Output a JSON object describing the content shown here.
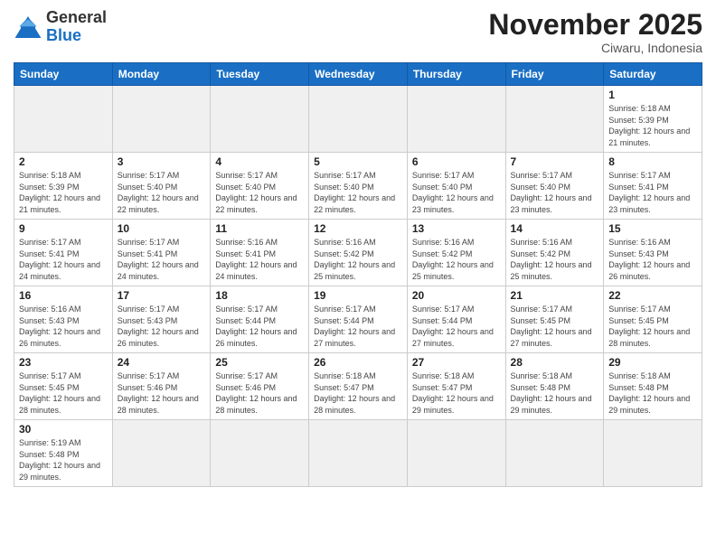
{
  "logo": {
    "text_general": "General",
    "text_blue": "Blue"
  },
  "header": {
    "month_year": "November 2025",
    "location": "Ciwaru, Indonesia"
  },
  "days_of_week": [
    "Sunday",
    "Monday",
    "Tuesday",
    "Wednesday",
    "Thursday",
    "Friday",
    "Saturday"
  ],
  "weeks": [
    [
      {
        "day": "",
        "empty": true
      },
      {
        "day": "",
        "empty": true
      },
      {
        "day": "",
        "empty": true
      },
      {
        "day": "",
        "empty": true
      },
      {
        "day": "",
        "empty": true
      },
      {
        "day": "",
        "empty": true
      },
      {
        "day": "1",
        "sunrise": "5:18 AM",
        "sunset": "5:39 PM",
        "daylight": "12 hours and 21 minutes."
      }
    ],
    [
      {
        "day": "2",
        "sunrise": "5:18 AM",
        "sunset": "5:39 PM",
        "daylight": "12 hours and 21 minutes."
      },
      {
        "day": "3",
        "sunrise": "5:17 AM",
        "sunset": "5:40 PM",
        "daylight": "12 hours and 22 minutes."
      },
      {
        "day": "4",
        "sunrise": "5:17 AM",
        "sunset": "5:40 PM",
        "daylight": "12 hours and 22 minutes."
      },
      {
        "day": "5",
        "sunrise": "5:17 AM",
        "sunset": "5:40 PM",
        "daylight": "12 hours and 22 minutes."
      },
      {
        "day": "6",
        "sunrise": "5:17 AM",
        "sunset": "5:40 PM",
        "daylight": "12 hours and 23 minutes."
      },
      {
        "day": "7",
        "sunrise": "5:17 AM",
        "sunset": "5:40 PM",
        "daylight": "12 hours and 23 minutes."
      },
      {
        "day": "8",
        "sunrise": "5:17 AM",
        "sunset": "5:41 PM",
        "daylight": "12 hours and 23 minutes."
      }
    ],
    [
      {
        "day": "9",
        "sunrise": "5:17 AM",
        "sunset": "5:41 PM",
        "daylight": "12 hours and 24 minutes."
      },
      {
        "day": "10",
        "sunrise": "5:17 AM",
        "sunset": "5:41 PM",
        "daylight": "12 hours and 24 minutes."
      },
      {
        "day": "11",
        "sunrise": "5:16 AM",
        "sunset": "5:41 PM",
        "daylight": "12 hours and 24 minutes."
      },
      {
        "day": "12",
        "sunrise": "5:16 AM",
        "sunset": "5:42 PM",
        "daylight": "12 hours and 25 minutes."
      },
      {
        "day": "13",
        "sunrise": "5:16 AM",
        "sunset": "5:42 PM",
        "daylight": "12 hours and 25 minutes."
      },
      {
        "day": "14",
        "sunrise": "5:16 AM",
        "sunset": "5:42 PM",
        "daylight": "12 hours and 25 minutes."
      },
      {
        "day": "15",
        "sunrise": "5:16 AM",
        "sunset": "5:43 PM",
        "daylight": "12 hours and 26 minutes."
      }
    ],
    [
      {
        "day": "16",
        "sunrise": "5:16 AM",
        "sunset": "5:43 PM",
        "daylight": "12 hours and 26 minutes."
      },
      {
        "day": "17",
        "sunrise": "5:17 AM",
        "sunset": "5:43 PM",
        "daylight": "12 hours and 26 minutes."
      },
      {
        "day": "18",
        "sunrise": "5:17 AM",
        "sunset": "5:44 PM",
        "daylight": "12 hours and 26 minutes."
      },
      {
        "day": "19",
        "sunrise": "5:17 AM",
        "sunset": "5:44 PM",
        "daylight": "12 hours and 27 minutes."
      },
      {
        "day": "20",
        "sunrise": "5:17 AM",
        "sunset": "5:44 PM",
        "daylight": "12 hours and 27 minutes."
      },
      {
        "day": "21",
        "sunrise": "5:17 AM",
        "sunset": "5:45 PM",
        "daylight": "12 hours and 27 minutes."
      },
      {
        "day": "22",
        "sunrise": "5:17 AM",
        "sunset": "5:45 PM",
        "daylight": "12 hours and 28 minutes."
      }
    ],
    [
      {
        "day": "23",
        "sunrise": "5:17 AM",
        "sunset": "5:45 PM",
        "daylight": "12 hours and 28 minutes."
      },
      {
        "day": "24",
        "sunrise": "5:17 AM",
        "sunset": "5:46 PM",
        "daylight": "12 hours and 28 minutes."
      },
      {
        "day": "25",
        "sunrise": "5:17 AM",
        "sunset": "5:46 PM",
        "daylight": "12 hours and 28 minutes."
      },
      {
        "day": "26",
        "sunrise": "5:18 AM",
        "sunset": "5:47 PM",
        "daylight": "12 hours and 28 minutes."
      },
      {
        "day": "27",
        "sunrise": "5:18 AM",
        "sunset": "5:47 PM",
        "daylight": "12 hours and 29 minutes."
      },
      {
        "day": "28",
        "sunrise": "5:18 AM",
        "sunset": "5:48 PM",
        "daylight": "12 hours and 29 minutes."
      },
      {
        "day": "29",
        "sunrise": "5:18 AM",
        "sunset": "5:48 PM",
        "daylight": "12 hours and 29 minutes."
      }
    ],
    [
      {
        "day": "30",
        "sunrise": "5:19 AM",
        "sunset": "5:48 PM",
        "daylight": "12 hours and 29 minutes."
      },
      {
        "day": "",
        "empty": true
      },
      {
        "day": "",
        "empty": true
      },
      {
        "day": "",
        "empty": true
      },
      {
        "day": "",
        "empty": true
      },
      {
        "day": "",
        "empty": true
      },
      {
        "day": "",
        "empty": true
      }
    ]
  ]
}
